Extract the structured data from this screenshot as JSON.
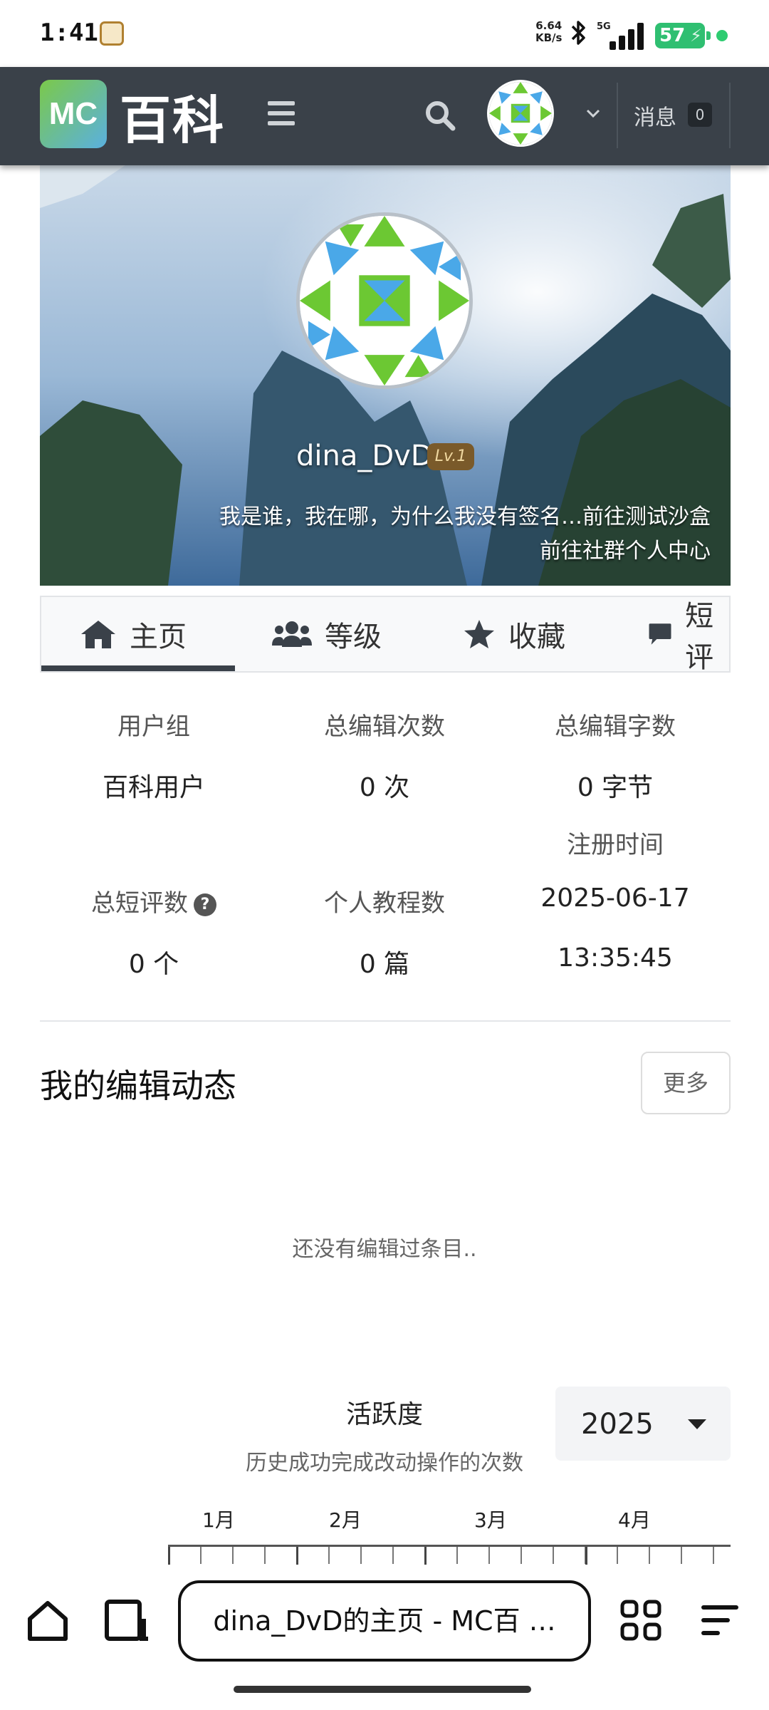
{
  "status_bar": {
    "time": "1:41",
    "net_speed_value": "6.64",
    "net_speed_unit": "KB/s",
    "network": "5G",
    "battery": "57"
  },
  "header": {
    "logo_badge": "MC",
    "logo_text": "百科",
    "messages_label": "消息",
    "messages_count": "0"
  },
  "profile": {
    "username": "dina_DvD",
    "level": "Lv.1",
    "signature": "我是谁，我在哪，为什么我没有签名…",
    "sandbox_link": "前往测试沙盒",
    "community_link": "前往社群个人中心"
  },
  "tabs": [
    {
      "label": "主页",
      "icon": "home-icon"
    },
    {
      "label": "等级",
      "icon": "users-icon"
    },
    {
      "label": "收藏",
      "icon": "star-icon"
    },
    {
      "label": "短评",
      "icon": "comment-icon"
    }
  ],
  "stats": {
    "user_group_label": "用户组",
    "user_group_value": "百科用户",
    "edit_count_label": "总编辑次数",
    "edit_count_value": "0 次",
    "edit_bytes_label": "总编辑字数",
    "edit_bytes_value": "0 字节",
    "reg_time_label": "注册时间",
    "reg_date": "2025-06-17",
    "reg_time": "13:35:45",
    "short_comment_label": "总短评数",
    "short_comment_value": "0 个",
    "tutorial_label": "个人教程数",
    "tutorial_value": "0 篇"
  },
  "edits": {
    "title": "我的编辑动态",
    "more_button": "更多",
    "empty_text": "还没有编辑过条目.."
  },
  "activity": {
    "title": "活跃度",
    "subtitle": "历史成功完成改动操作的次数",
    "year": "2025",
    "months": [
      "1月",
      "2月",
      "3月",
      "4月"
    ]
  },
  "browser": {
    "url_title": "dina_DvD的主页 - MC百 …"
  },
  "colors": {
    "header_bg": "#3a4149",
    "battery": "#2fbf71",
    "logo_green": "#7bc94a",
    "logo_blue": "#5ab0e0"
  }
}
